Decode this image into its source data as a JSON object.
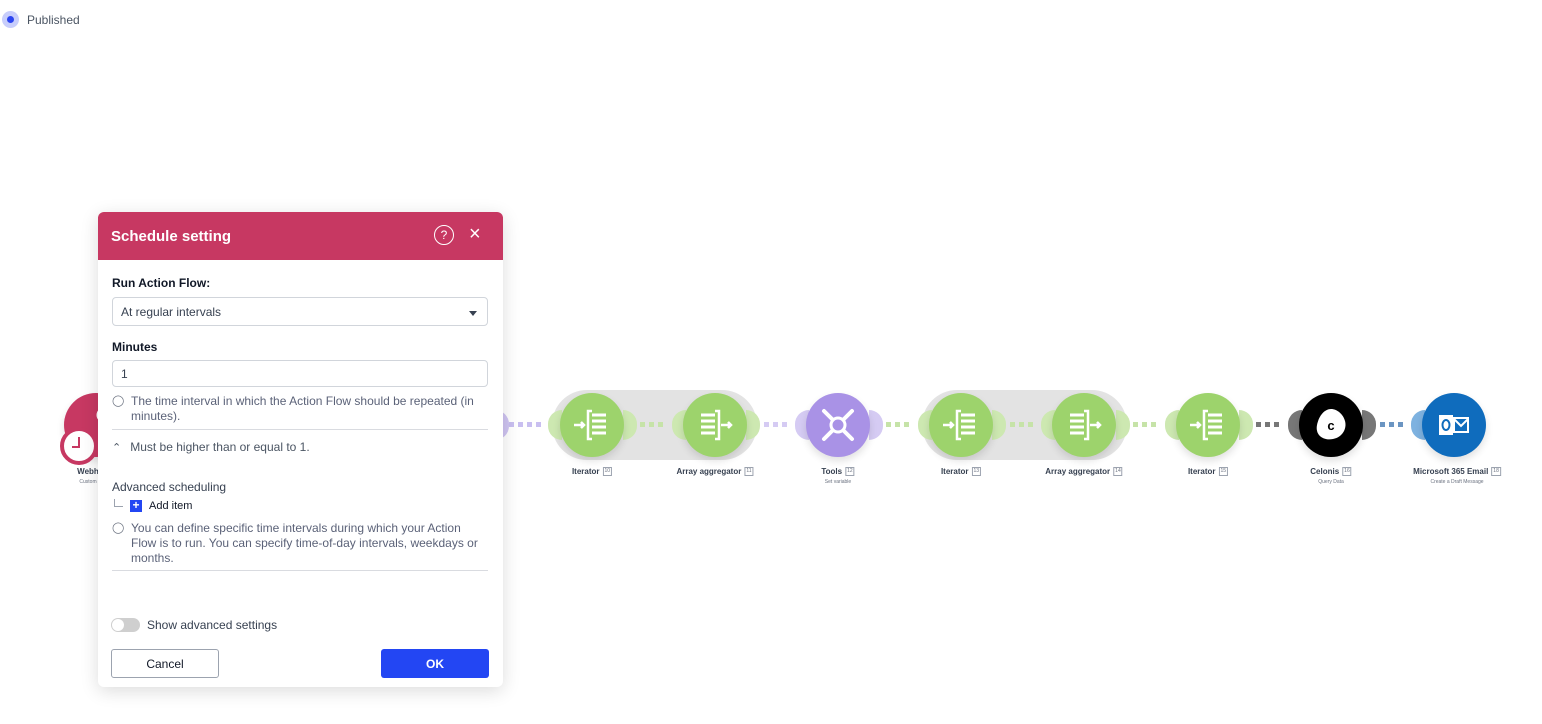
{
  "status": {
    "label": "Published",
    "color": "#2b44f0"
  },
  "flow": {
    "nodes": [
      {
        "id": "webhook",
        "title": "Webh",
        "number": "",
        "subtitle": "Custom",
        "color": "#c73862",
        "icon": "webhook-clock-icon"
      },
      {
        "id": "iterator-10",
        "title": "Iterator",
        "number": "10",
        "subtitle": "",
        "color": "#9dd36c",
        "icon": "iterator-icon"
      },
      {
        "id": "aggregator-11",
        "title": "Array aggregator",
        "number": "11",
        "subtitle": "",
        "color": "#9dd36c",
        "icon": "array-aggregator-icon"
      },
      {
        "id": "tools-12",
        "title": "Tools",
        "number": "12",
        "subtitle": "Set variable",
        "color": "#a992e6",
        "icon": "tools-icon"
      },
      {
        "id": "iterator-13",
        "title": "Iterator",
        "number": "13",
        "subtitle": "",
        "color": "#9dd36c",
        "icon": "iterator-icon"
      },
      {
        "id": "aggregator-14",
        "title": "Array aggregator",
        "number": "14",
        "subtitle": "",
        "color": "#9dd36c",
        "icon": "array-aggregator-icon"
      },
      {
        "id": "iterator-15",
        "title": "Iterator",
        "number": "15",
        "subtitle": "",
        "color": "#9dd36c",
        "icon": "iterator-icon"
      },
      {
        "id": "celonis-16",
        "title": "Celonis",
        "number": "16",
        "subtitle": "Query Data",
        "color": "#000000",
        "icon": "celonis-icon"
      },
      {
        "id": "ms365-18",
        "title": "Microsoft 365 Email",
        "number": "18",
        "subtitle": "Create a Draft Message",
        "color": "#0f6cbd",
        "icon": "outlook-icon"
      }
    ]
  },
  "dialog": {
    "title": "Schedule setting",
    "help_icon": "?",
    "close_icon": "×",
    "run_label": "Run Action Flow:",
    "run_value": "At regular intervals",
    "minutes_label": "Minutes",
    "minutes_value": "1",
    "minutes_hint": "The time interval in which the Action Flow should be repeated (in minutes).",
    "validation": "Must be higher than or equal to 1.",
    "advanced_title": "Advanced scheduling",
    "add_item": "Add item",
    "advanced_hint": "You can define specific time intervals during which your Action Flow is to run. You can specify time-of-day intervals, weekdays or months.",
    "show_advanced": "Show advanced settings",
    "show_advanced_on": false,
    "cancel": "Cancel",
    "ok": "OK"
  }
}
